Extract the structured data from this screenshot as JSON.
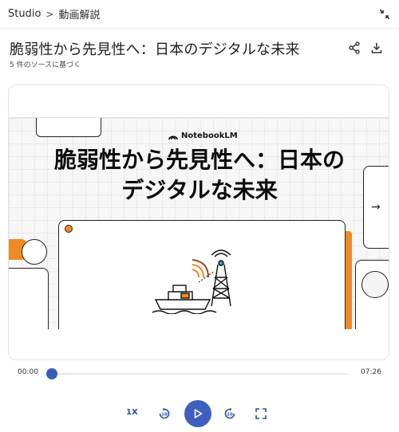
{
  "header": {
    "breadcrumb_root": "Studio",
    "breadcrumb_separator": ">",
    "breadcrumb_current": "動画解説"
  },
  "title": "脆弱性から先見性へ：日本のデジタルな未来",
  "subtitle": "5 件のソースに基づく",
  "slide": {
    "brand": "NotebookLM",
    "title_line1": "脆弱性から先見性へ：日本の",
    "title_line2": "デジタルな未来",
    "next_arrow": "→"
  },
  "playback": {
    "current_time": "00:00",
    "duration": "07:26",
    "progress": 0.0,
    "speed": "1X"
  },
  "colors": {
    "accent": "#3e5ec0",
    "orange": "#f08a24",
    "speed_text": "#2b4fa6"
  },
  "icons": {
    "collapse": "collapse-icon",
    "share": "share-icon",
    "download": "download-icon",
    "rewind": "rewind-10-icon",
    "play": "play-icon",
    "forward": "forward-10-icon",
    "fullscreen": "fullscreen-icon"
  }
}
